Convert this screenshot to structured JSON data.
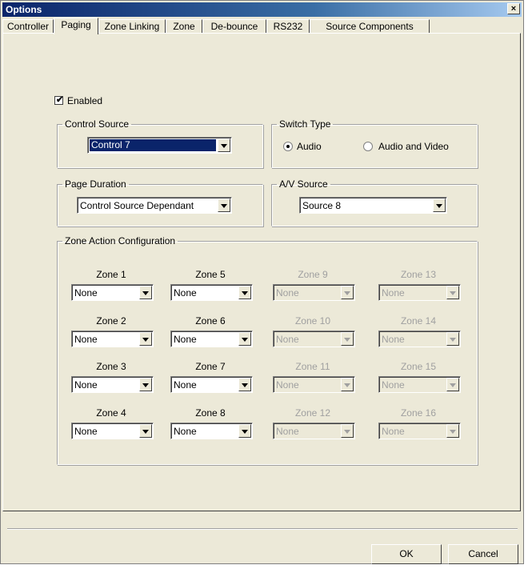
{
  "window": {
    "title": "Options",
    "close_label": "×"
  },
  "tabs": [
    {
      "label": "Controller"
    },
    {
      "label": "Paging"
    },
    {
      "label": "Zone Linking"
    },
    {
      "label": "Zone"
    },
    {
      "label": "De-bounce"
    },
    {
      "label": "RS232"
    },
    {
      "label": "Source Components"
    }
  ],
  "active_tab": "Paging",
  "paging": {
    "enabled_label": "Enabled",
    "enabled_checked": true,
    "control_source": {
      "legend": "Control Source",
      "value": "Control 7"
    },
    "switch_type": {
      "legend": "Switch Type",
      "options": [
        "Audio",
        "Audio and Video"
      ],
      "selected": "Audio"
    },
    "page_duration": {
      "legend": "Page Duration",
      "value": "Control Source Dependant"
    },
    "av_source": {
      "legend": "A/V Source",
      "value": "Source 8"
    },
    "zone_action": {
      "legend": "Zone Action Configuration",
      "zones": [
        {
          "label": "Zone 1",
          "value": "None",
          "enabled": true
        },
        {
          "label": "Zone 2",
          "value": "None",
          "enabled": true
        },
        {
          "label": "Zone 3",
          "value": "None",
          "enabled": true
        },
        {
          "label": "Zone 4",
          "value": "None",
          "enabled": true
        },
        {
          "label": "Zone 5",
          "value": "None",
          "enabled": true
        },
        {
          "label": "Zone 6",
          "value": "None",
          "enabled": true
        },
        {
          "label": "Zone 7",
          "value": "None",
          "enabled": true
        },
        {
          "label": "Zone 8",
          "value": "None",
          "enabled": true
        },
        {
          "label": "Zone 9",
          "value": "None",
          "enabled": false
        },
        {
          "label": "Zone 10",
          "value": "None",
          "enabled": false
        },
        {
          "label": "Zone 11",
          "value": "None",
          "enabled": false
        },
        {
          "label": "Zone 12",
          "value": "None",
          "enabled": false
        },
        {
          "label": "Zone 13",
          "value": "None",
          "enabled": false
        },
        {
          "label": "Zone 14",
          "value": "None",
          "enabled": false
        },
        {
          "label": "Zone 15",
          "value": "None",
          "enabled": false
        },
        {
          "label": "Zone 16",
          "value": "None",
          "enabled": false
        }
      ]
    }
  },
  "buttons": {
    "ok": "OK",
    "cancel": "Cancel"
  }
}
